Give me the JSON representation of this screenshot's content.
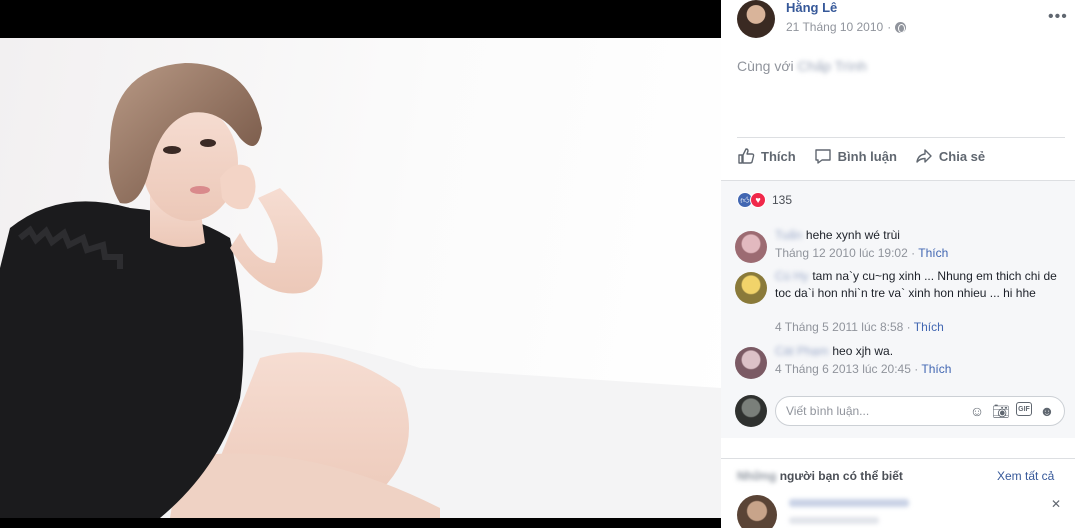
{
  "post": {
    "author": "Hằng Lê",
    "date": "21 Tháng 10 2010",
    "with_prefix": "Cùng với",
    "with_name": "Chấp Trình"
  },
  "actions": {
    "like": "Thích",
    "comment": "Bình luận",
    "share": "Chia sẻ"
  },
  "reactions": {
    "count": "135"
  },
  "comments": [
    {
      "name": "Tuấn",
      "text": "hehe xynh wé trùi",
      "meta": "Tháng 12 2010 lúc 19:02 ·",
      "like": "Thích"
    },
    {
      "name": "Cú Hy",
      "text": "tam na`y cu~ng xinh ... Nhung em thich chi de toc da`i hon nhi`n tre va` xinh hon nhieu ... hi hhe",
      "meta": "4 Tháng 5 2011 lúc 8:58 ·",
      "like": "Thích"
    },
    {
      "name": "Cát Phạm",
      "text": "heo xjh wa.",
      "meta": "4 Tháng 6 2013 lúc 20:45 ·",
      "like": "Thích"
    }
  ],
  "composer": {
    "placeholder": "Viết bình luận..."
  },
  "pymk": {
    "title_hidden": "Những",
    "title": "người bạn có thể biết",
    "see_all": "Xem tất cả"
  },
  "colors": {
    "link": "#365899",
    "accent": "#4267b2",
    "love": "#f0284a",
    "muted": "#90949c"
  }
}
